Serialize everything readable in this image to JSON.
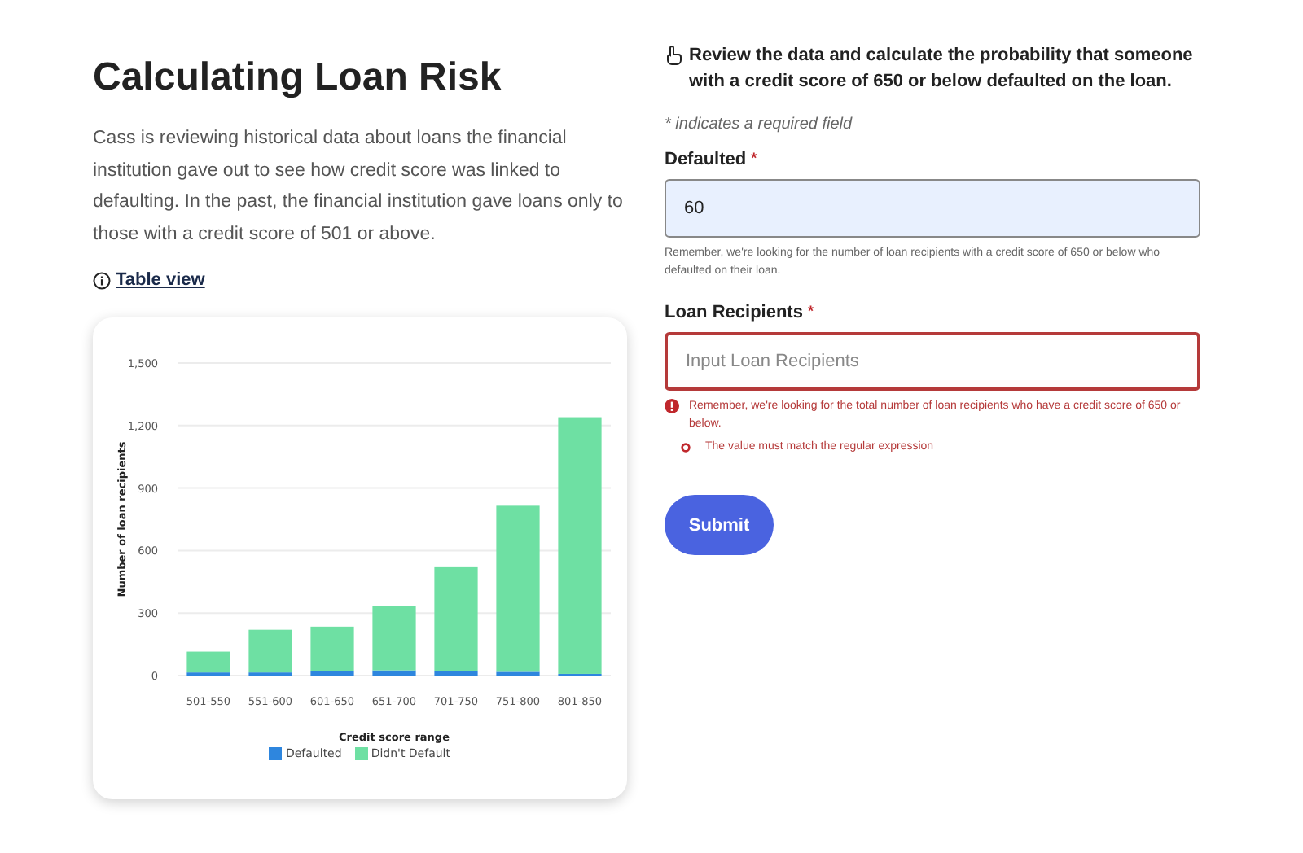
{
  "title": "Calculating Loan Risk",
  "intro": "Cass is reviewing historical data about loans the financial institution gave out to see how credit score was linked to defaulting. In the past, the financial institution gave loans only to those with a credit score of 501 or above.",
  "table_link": "Table view",
  "chart": {
    "chart_data": {
      "type": "bar",
      "stacked": true,
      "grid": true,
      "legend": true,
      "xlabel": "Credit score range",
      "ylabel": "Number of loan recipients",
      "categories": [
        "501-550",
        "551-600",
        "601-650",
        "651-700",
        "701-750",
        "751-800",
        "801-850"
      ],
      "ylim": [
        0,
        1500
      ],
      "yticks": [
        {
          "value": 0,
          "label": "0"
        },
        {
          "value": 300,
          "label": "300"
        },
        {
          "value": 600,
          "label": "600"
        },
        {
          "value": 900,
          "label": "900"
        },
        {
          "value": 1200,
          "label": "1,200"
        },
        {
          "value": 1500,
          "label": "1,500"
        }
      ],
      "series": [
        {
          "name": "Defaulted",
          "color": "#2e86de",
          "values": [
            15,
            15,
            20,
            25,
            22,
            18,
            8
          ]
        },
        {
          "name": "Didn't Default",
          "color": "#6ee0a3",
          "values": [
            100,
            205,
            215,
            310,
            498,
            797,
            1232
          ]
        }
      ]
    }
  },
  "question": "Review the data and calculate the probability that someone with a credit score of 650 or below defaulted on the loan.",
  "required_note": "* indicates a required field",
  "fields": [
    {
      "label": "Defaulted",
      "required_mark": "*",
      "value": "60",
      "hint": "Remember, we're looking for the number of loan recipients with a credit score of 650 or below who defaulted on their loan.",
      "error": false
    },
    {
      "label": "Loan Recipients",
      "required_mark": "*",
      "placeholder": "Input Loan Recipients",
      "hint": "Remember, we're looking for the total number of loan recipients who have a credit score of 650 or below.",
      "error": true,
      "sub_error": "The value must match the regular expression"
    }
  ],
  "submit": "Submit"
}
